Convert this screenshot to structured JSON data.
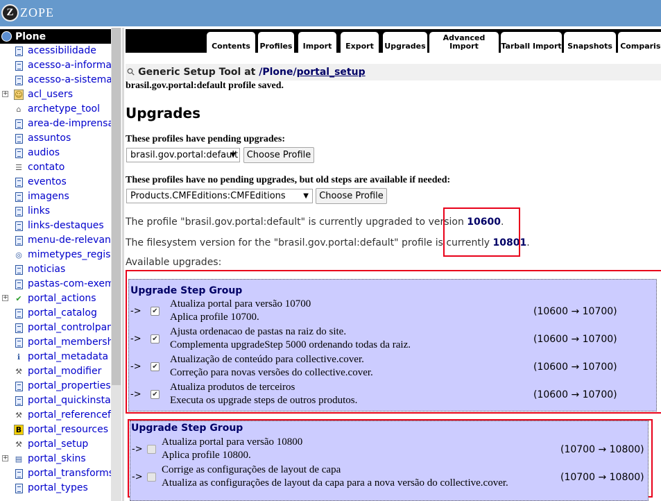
{
  "header": {
    "logo_letter": "Z",
    "logo_text": "ZOPE"
  },
  "tree": {
    "root": "Plone",
    "items": [
      {
        "label": "acessibilidade",
        "icon": "document-icon",
        "plus": false
      },
      {
        "label": "acesso-a-informa",
        "icon": "document-icon",
        "plus": false
      },
      {
        "label": "acesso-a-sistema",
        "icon": "document-icon",
        "plus": false
      },
      {
        "label": "acl_users",
        "icon": "user-folder-icon",
        "plus": true
      },
      {
        "label": "archetype_tool",
        "icon": "tool-icon",
        "plus": false
      },
      {
        "label": "area-de-imprensa",
        "icon": "document-icon",
        "plus": false
      },
      {
        "label": "assuntos",
        "icon": "document-icon",
        "plus": false
      },
      {
        "label": "audios",
        "icon": "document-icon",
        "plus": false
      },
      {
        "label": "contato",
        "icon": "form-icon",
        "plus": false
      },
      {
        "label": "eventos",
        "icon": "document-icon",
        "plus": false
      },
      {
        "label": "imagens",
        "icon": "document-icon",
        "plus": false
      },
      {
        "label": "links",
        "icon": "document-icon",
        "plus": false
      },
      {
        "label": "links-destaques",
        "icon": "document-icon",
        "plus": false
      },
      {
        "label": "menu-de-relevanc",
        "icon": "document-icon",
        "plus": false
      },
      {
        "label": "mimetypes_regist",
        "icon": "mimetype-icon",
        "plus": false
      },
      {
        "label": "noticias",
        "icon": "document-icon",
        "plus": false
      },
      {
        "label": "pastas-com-exem",
        "icon": "document-icon",
        "plus": false
      },
      {
        "label": "portal_actions",
        "icon": "check-icon",
        "plus": true
      },
      {
        "label": "portal_catalog",
        "icon": "document-icon",
        "plus": false
      },
      {
        "label": "portal_controlpan",
        "icon": "document-icon",
        "plus": false
      },
      {
        "label": "portal_membersh",
        "icon": "document-icon",
        "plus": false
      },
      {
        "label": "portal_metadata",
        "icon": "info-icon",
        "plus": false
      },
      {
        "label": "portal_modifier",
        "icon": "wrench-icon",
        "plus": false
      },
      {
        "label": "portal_properties",
        "icon": "document-icon",
        "plus": false
      },
      {
        "label": "portal_quickinstal",
        "icon": "document-icon",
        "plus": false
      },
      {
        "label": "portal_referencefa",
        "icon": "wrench-icon",
        "plus": false
      },
      {
        "label": "portal_resources",
        "icon": "resources-icon",
        "plus": false
      },
      {
        "label": "portal_setup",
        "icon": "wrench-icon",
        "plus": false
      },
      {
        "label": "portal_skins",
        "icon": "skins-icon",
        "plus": true
      },
      {
        "label": "portal_transforms",
        "icon": "document-icon",
        "plus": false
      },
      {
        "label": "portal_types",
        "icon": "document-icon",
        "plus": false
      }
    ]
  },
  "tabs": [
    "Contents",
    "Profiles",
    "Import",
    "Export",
    "Upgrades",
    "Advanced Import",
    "Tarball Import",
    "Snapshots",
    "Comparison"
  ],
  "breadcrumb": {
    "title": "Generic Setup Tool at",
    "root": "/Plone/",
    "link": "portal_setup"
  },
  "saved_msg": "brasil.gov.portal:default profile saved.",
  "heading": "Upgrades",
  "pending": {
    "label": "These profiles have pending upgrades:",
    "selected": "brasil.gov.portal:default",
    "button": "Choose Profile"
  },
  "nopending": {
    "label": "These profiles have no pending upgrades, but old steps are available if needed:",
    "selected": "Products.CMFEditions:CMFEditions",
    "button": "Choose Profile"
  },
  "version_line": {
    "pre": "The profile \"brasil.gov.portal:default\" is currently upgraded to version ",
    "value": "10600",
    "post": "."
  },
  "fs_line": {
    "pre": "The filesystem version for the \"brasil.gov.portal:default\" profile is currently ",
    "value": "10801",
    "post": "."
  },
  "available": "Available upgrades:",
  "groups": [
    {
      "title": "Upgrade Step Group",
      "steps": [
        {
          "arrow": "->",
          "checked": true,
          "title": "Atualiza portal para versão 10700",
          "desc": "Aplica profile 10700.",
          "version": "(10600 → 10700)"
        },
        {
          "arrow": "->",
          "checked": true,
          "title": "Ajusta ordenacao de pastas na raiz do site.",
          "desc": "Complementa upgradeStep 5000 ordenando todas da raiz.",
          "version": "(10600 → 10700)"
        },
        {
          "arrow": "->",
          "checked": true,
          "title": "Atualização de conteúdo para collective.cover.",
          "desc": "Correção para novas versões do collective.cover.",
          "version": "(10600 → 10700)"
        },
        {
          "arrow": "->",
          "checked": true,
          "title": "Atualiza produtos de terceiros",
          "desc": "Executa os upgrade steps de outros produtos.",
          "version": "(10600 → 10700)"
        }
      ]
    },
    {
      "title": "Upgrade Step Group",
      "steps": [
        {
          "arrow": "->",
          "checked": false,
          "title": "Atualiza portal para versão 10800",
          "desc": "Aplica profile 10800.",
          "version": "(10700 → 10800)"
        },
        {
          "arrow": "->",
          "checked": false,
          "title": "Corrige as configurações de layout de capa",
          "desc": "Atualiza as configurações de layout da capa para a nova versão do collective.cover.",
          "version": "(10700 → 10800)"
        }
      ]
    }
  ]
}
